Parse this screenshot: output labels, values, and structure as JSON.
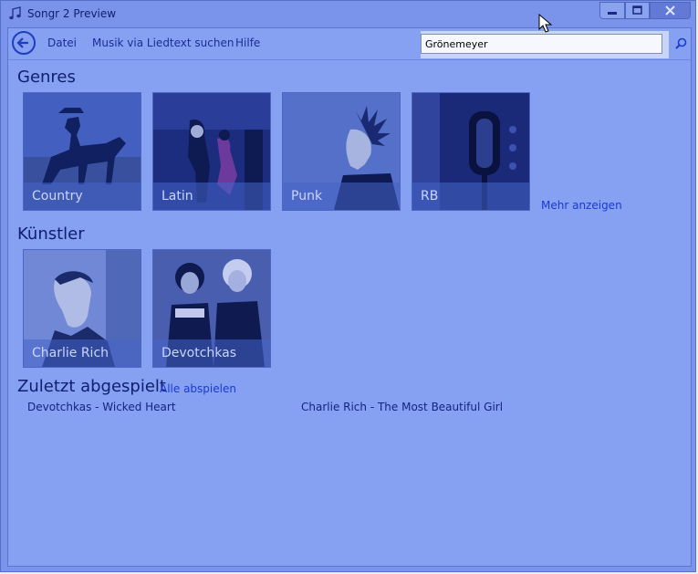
{
  "window": {
    "title": "Songr 2 Preview"
  },
  "menu": {
    "file": "Datei",
    "lyrics_search": "Musik via Liedtext suchen",
    "help": "Hilfe"
  },
  "search": {
    "value": "Grönemeyer"
  },
  "genres": {
    "title": "Genres",
    "items": [
      {
        "label": "Country"
      },
      {
        "label": "Latin"
      },
      {
        "label": "Punk"
      },
      {
        "label": "RB"
      }
    ],
    "more_label": "Mehr anzeigen"
  },
  "artists": {
    "title": "Künstler",
    "items": [
      {
        "label": "Charlie Rich"
      },
      {
        "label": "Devotchkas"
      }
    ]
  },
  "recent": {
    "title": "Zuletzt abgespielt",
    "play_all": "Alle abspielen",
    "items": [
      {
        "label": "Devotchkas - Wicked Heart"
      },
      {
        "label": "Charlie Rich - The Most Beautiful Girl"
      }
    ]
  },
  "colors": {
    "background": "#86a0f2",
    "accent": "#1a3bd0",
    "text": "#10206e"
  }
}
